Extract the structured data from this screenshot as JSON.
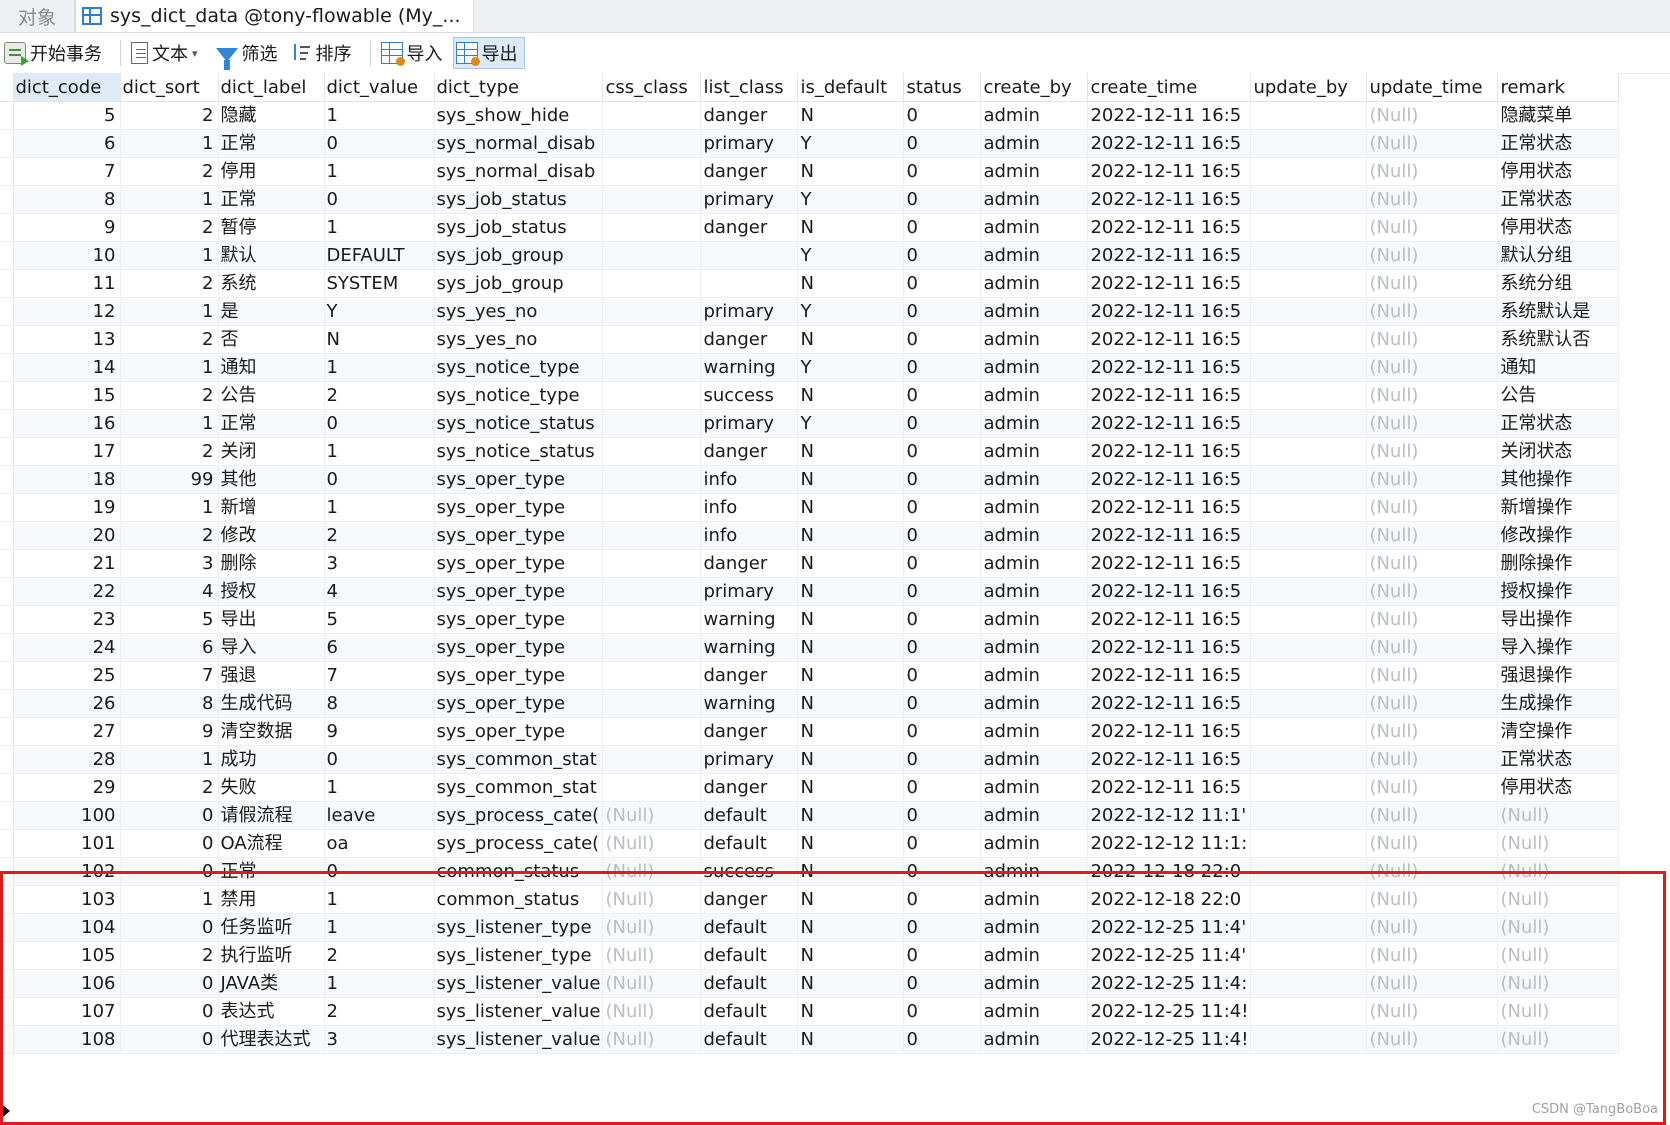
{
  "tabs": {
    "objects_label": "对象",
    "active_label": "sys_dict_data @tony-flowable (My_..."
  },
  "toolbar": {
    "begin_tx_label": "开始事务",
    "text_label": "文本",
    "filter_label": "筛选",
    "sort_label": "排序",
    "import_label": "导入",
    "export_label": "导出"
  },
  "columns": [
    "dict_code",
    "dict_sort",
    "dict_label",
    "dict_value",
    "dict_type",
    "css_class",
    "list_class",
    "is_default",
    "status",
    "create_by",
    "create_time",
    "update_by",
    "update_time",
    "remark"
  ],
  "rows": [
    [
      "5",
      "2",
      "隐藏",
      "1",
      "sys_show_hide",
      "",
      "danger",
      "N",
      "0",
      "admin",
      "2022-12-11 16:5",
      "",
      "(Null)",
      "隐藏菜单"
    ],
    [
      "6",
      "1",
      "正常",
      "0",
      "sys_normal_disab",
      "",
      "primary",
      "Y",
      "0",
      "admin",
      "2022-12-11 16:5",
      "",
      "(Null)",
      "正常状态"
    ],
    [
      "7",
      "2",
      "停用",
      "1",
      "sys_normal_disab",
      "",
      "danger",
      "N",
      "0",
      "admin",
      "2022-12-11 16:5",
      "",
      "(Null)",
      "停用状态"
    ],
    [
      "8",
      "1",
      "正常",
      "0",
      "sys_job_status",
      "",
      "primary",
      "Y",
      "0",
      "admin",
      "2022-12-11 16:5",
      "",
      "(Null)",
      "正常状态"
    ],
    [
      "9",
      "2",
      "暂停",
      "1",
      "sys_job_status",
      "",
      "danger",
      "N",
      "0",
      "admin",
      "2022-12-11 16:5",
      "",
      "(Null)",
      "停用状态"
    ],
    [
      "10",
      "1",
      "默认",
      "DEFAULT",
      "sys_job_group",
      "",
      "",
      "Y",
      "0",
      "admin",
      "2022-12-11 16:5",
      "",
      "(Null)",
      "默认分组"
    ],
    [
      "11",
      "2",
      "系统",
      "SYSTEM",
      "sys_job_group",
      "",
      "",
      "N",
      "0",
      "admin",
      "2022-12-11 16:5",
      "",
      "(Null)",
      "系统分组"
    ],
    [
      "12",
      "1",
      "是",
      "Y",
      "sys_yes_no",
      "",
      "primary",
      "Y",
      "0",
      "admin",
      "2022-12-11 16:5",
      "",
      "(Null)",
      "系统默认是"
    ],
    [
      "13",
      "2",
      "否",
      "N",
      "sys_yes_no",
      "",
      "danger",
      "N",
      "0",
      "admin",
      "2022-12-11 16:5",
      "",
      "(Null)",
      "系统默认否"
    ],
    [
      "14",
      "1",
      "通知",
      "1",
      "sys_notice_type",
      "",
      "warning",
      "Y",
      "0",
      "admin",
      "2022-12-11 16:5",
      "",
      "(Null)",
      "通知"
    ],
    [
      "15",
      "2",
      "公告",
      "2",
      "sys_notice_type",
      "",
      "success",
      "N",
      "0",
      "admin",
      "2022-12-11 16:5",
      "",
      "(Null)",
      "公告"
    ],
    [
      "16",
      "1",
      "正常",
      "0",
      "sys_notice_status",
      "",
      "primary",
      "Y",
      "0",
      "admin",
      "2022-12-11 16:5",
      "",
      "(Null)",
      "正常状态"
    ],
    [
      "17",
      "2",
      "关闭",
      "1",
      "sys_notice_status",
      "",
      "danger",
      "N",
      "0",
      "admin",
      "2022-12-11 16:5",
      "",
      "(Null)",
      "关闭状态"
    ],
    [
      "18",
      "99",
      "其他",
      "0",
      "sys_oper_type",
      "",
      "info",
      "N",
      "0",
      "admin",
      "2022-12-11 16:5",
      "",
      "(Null)",
      "其他操作"
    ],
    [
      "19",
      "1",
      "新增",
      "1",
      "sys_oper_type",
      "",
      "info",
      "N",
      "0",
      "admin",
      "2022-12-11 16:5",
      "",
      "(Null)",
      "新增操作"
    ],
    [
      "20",
      "2",
      "修改",
      "2",
      "sys_oper_type",
      "",
      "info",
      "N",
      "0",
      "admin",
      "2022-12-11 16:5",
      "",
      "(Null)",
      "修改操作"
    ],
    [
      "21",
      "3",
      "删除",
      "3",
      "sys_oper_type",
      "",
      "danger",
      "N",
      "0",
      "admin",
      "2022-12-11 16:5",
      "",
      "(Null)",
      "删除操作"
    ],
    [
      "22",
      "4",
      "授权",
      "4",
      "sys_oper_type",
      "",
      "primary",
      "N",
      "0",
      "admin",
      "2022-12-11 16:5",
      "",
      "(Null)",
      "授权操作"
    ],
    [
      "23",
      "5",
      "导出",
      "5",
      "sys_oper_type",
      "",
      "warning",
      "N",
      "0",
      "admin",
      "2022-12-11 16:5",
      "",
      "(Null)",
      "导出操作"
    ],
    [
      "24",
      "6",
      "导入",
      "6",
      "sys_oper_type",
      "",
      "warning",
      "N",
      "0",
      "admin",
      "2022-12-11 16:5",
      "",
      "(Null)",
      "导入操作"
    ],
    [
      "25",
      "7",
      "强退",
      "7",
      "sys_oper_type",
      "",
      "danger",
      "N",
      "0",
      "admin",
      "2022-12-11 16:5",
      "",
      "(Null)",
      "强退操作"
    ],
    [
      "26",
      "8",
      "生成代码",
      "8",
      "sys_oper_type",
      "",
      "warning",
      "N",
      "0",
      "admin",
      "2022-12-11 16:5",
      "",
      "(Null)",
      "生成操作"
    ],
    [
      "27",
      "9",
      "清空数据",
      "9",
      "sys_oper_type",
      "",
      "danger",
      "N",
      "0",
      "admin",
      "2022-12-11 16:5",
      "",
      "(Null)",
      "清空操作"
    ],
    [
      "28",
      "1",
      "成功",
      "0",
      "sys_common_stat",
      "",
      "primary",
      "N",
      "0",
      "admin",
      "2022-12-11 16:5",
      "",
      "(Null)",
      "正常状态"
    ],
    [
      "29",
      "2",
      "失败",
      "1",
      "sys_common_stat",
      "",
      "danger",
      "N",
      "0",
      "admin",
      "2022-12-11 16:5",
      "",
      "(Null)",
      "停用状态"
    ],
    [
      "100",
      "0",
      "请假流程",
      "leave",
      "sys_process_cate(",
      "(Null)",
      "default",
      "N",
      "0",
      "admin",
      "2022-12-12 11:1'",
      "",
      "(Null)",
      "(Null)"
    ],
    [
      "101",
      "0",
      "OA流程",
      "oa",
      "sys_process_cate(",
      "(Null)",
      "default",
      "N",
      "0",
      "admin",
      "2022-12-12 11:1:",
      "",
      "(Null)",
      "(Null)"
    ],
    [
      "102",
      "0",
      "正常",
      "0",
      "common_status",
      "(Null)",
      "success",
      "N",
      "0",
      "admin",
      "2022-12-18 22:0",
      "",
      "(Null)",
      "(Null)"
    ],
    [
      "103",
      "1",
      "禁用",
      "1",
      "common_status",
      "(Null)",
      "danger",
      "N",
      "0",
      "admin",
      "2022-12-18 22:0",
      "",
      "(Null)",
      "(Null)"
    ],
    [
      "104",
      "0",
      "任务监听",
      "1",
      "sys_listener_type",
      "(Null)",
      "default",
      "N",
      "0",
      "admin",
      "2022-12-25 11:4'",
      "",
      "(Null)",
      "(Null)"
    ],
    [
      "105",
      "2",
      "执行监听",
      "2",
      "sys_listener_type",
      "(Null)",
      "default",
      "N",
      "0",
      "admin",
      "2022-12-25 11:4'",
      "",
      "(Null)",
      "(Null)"
    ],
    [
      "106",
      "0",
      "JAVA类",
      "1",
      "sys_listener_value",
      "(Null)",
      "default",
      "N",
      "0",
      "admin",
      "2022-12-25 11:4:",
      "",
      "(Null)",
      "(Null)"
    ],
    [
      "107",
      "0",
      "表达式",
      "2",
      "sys_listener_value",
      "(Null)",
      "default",
      "N",
      "0",
      "admin",
      "2022-12-25 11:4!",
      "",
      "(Null)",
      "(Null)"
    ],
    [
      "108",
      "0",
      "代理表达式",
      "3",
      "sys_listener_value",
      "(Null)",
      "default",
      "N",
      "0",
      "admin",
      "2022-12-25 11:4!",
      "",
      "(Null)",
      "(Null)"
    ]
  ],
  "watermark": "CSDN @TangBoBoa",
  "colors": {
    "highlight_border": "#e11b1b",
    "null_text": "#b9bec6",
    "accent": "#2d7fd2"
  }
}
